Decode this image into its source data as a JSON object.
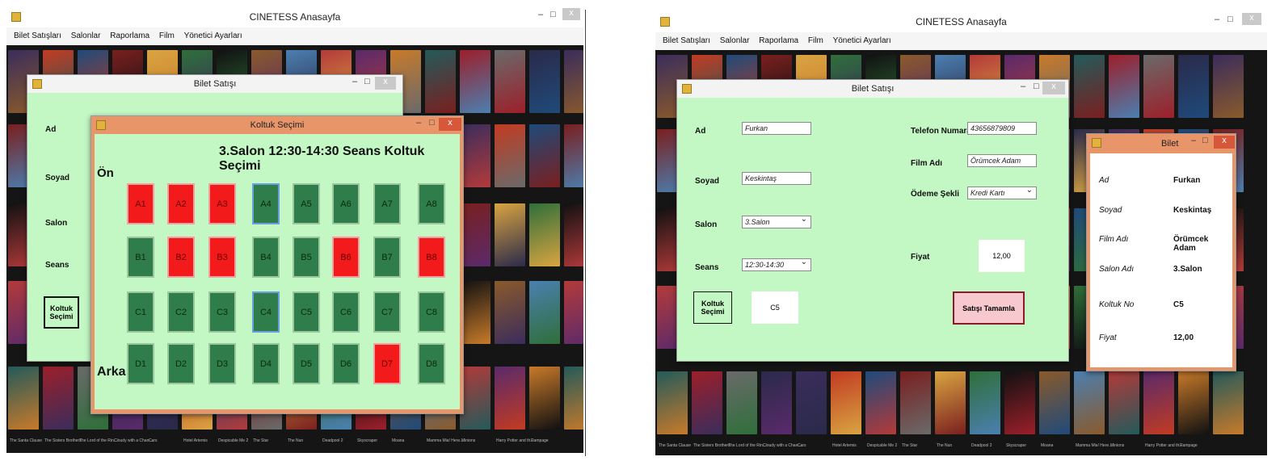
{
  "app_title": "CINETESS Anasayfa",
  "menu": [
    "Bilet Satışları",
    "Salonlar",
    "Raporlama",
    "Film",
    "Yönetici Ayarları"
  ],
  "left": {
    "bilet_window_title": "Bilet Satışı",
    "labels": {
      "ad": "Ad",
      "soyad": "Soyad",
      "salon": "Salon",
      "seans": "Seans"
    },
    "koltuk_button": "Koltuk\nSeçimi",
    "seat_window": {
      "title": "Koltuk Seçimi",
      "heading": "3.Salon 12:30-14:30 Seans Koltuk Seçimi",
      "front_label": "Ön",
      "back_label": "Arka",
      "rows": [
        {
          "row": "A",
          "seats": [
            {
              "id": "A1",
              "status": "taken"
            },
            {
              "id": "A2",
              "status": "taken"
            },
            {
              "id": "A3",
              "status": "taken"
            },
            {
              "id": "A4",
              "status": "free"
            },
            {
              "id": "A5",
              "status": "free"
            },
            {
              "id": "A6",
              "status": "free"
            },
            {
              "id": "A7",
              "status": "free"
            },
            {
              "id": "A8",
              "status": "free"
            }
          ]
        },
        {
          "row": "B",
          "seats": [
            {
              "id": "B1",
              "status": "free"
            },
            {
              "id": "B2",
              "status": "taken"
            },
            {
              "id": "B3",
              "status": "taken"
            },
            {
              "id": "B4",
              "status": "free"
            },
            {
              "id": "B5",
              "status": "free"
            },
            {
              "id": "B6",
              "status": "taken"
            },
            {
              "id": "B7",
              "status": "free"
            },
            {
              "id": "B8",
              "status": "taken"
            }
          ]
        },
        {
          "row": "C",
          "seats": [
            {
              "id": "C1",
              "status": "free"
            },
            {
              "id": "C2",
              "status": "free"
            },
            {
              "id": "C3",
              "status": "free"
            },
            {
              "id": "C4",
              "status": "free"
            },
            {
              "id": "C5",
              "status": "free"
            },
            {
              "id": "C6",
              "status": "free"
            },
            {
              "id": "C7",
              "status": "free"
            },
            {
              "id": "C8",
              "status": "free"
            }
          ]
        },
        {
          "row": "D",
          "seats": [
            {
              "id": "D1",
              "status": "free"
            },
            {
              "id": "D2",
              "status": "free"
            },
            {
              "id": "D3",
              "status": "free"
            },
            {
              "id": "D4",
              "status": "free"
            },
            {
              "id": "D5",
              "status": "free"
            },
            {
              "id": "D6",
              "status": "free"
            },
            {
              "id": "D7",
              "status": "taken"
            },
            {
              "id": "D8",
              "status": "free"
            }
          ]
        }
      ]
    },
    "poster_titles_bottom": [
      "The Santa Clause",
      "The Sisters Brothers",
      "The Lord of the Rin...",
      "Cloudy with a Chan...",
      "Cars",
      "Hotel Artemis",
      "Despicable Me 2",
      "The Star",
      "The Nun",
      "Deadpool 2",
      "Skyscraper",
      "Moana",
      "Mamma Mia! Here...",
      "Minions",
      "Harry Potter and th...",
      "Rampage"
    ]
  },
  "right": {
    "bilet_window_title": "Bilet Satışı",
    "labels": {
      "ad": "Ad",
      "soyad": "Soyad",
      "salon": "Salon",
      "seans": "Seans",
      "telefon": "Telefon Numarası",
      "film_adi": "Film Adı",
      "odeme": "Ödeme Şekli",
      "fiyat": "Fiyat"
    },
    "values": {
      "ad": "Furkan",
      "soyad": "Keskintaş",
      "salon": "3.Salon",
      "seans": "12:30-14:30",
      "telefon": "43656879809",
      "film_adi": "Örümcek Adam",
      "odeme": "Kredi Kartı",
      "fiyat": "12,00",
      "koltuk": "C5"
    },
    "koltuk_button": "Koltuk\nSeçimi",
    "complete_button": "Satışı Tamamla",
    "ticket": {
      "title": "Bilet",
      "rows": [
        {
          "label": "Ad",
          "value": "Furkan"
        },
        {
          "label": "Soyad",
          "value": "Keskintaş"
        },
        {
          "label": "Film Adı",
          "value": "Örümcek Adam"
        },
        {
          "label": "Salon Adı",
          "value": "3.Salon"
        },
        {
          "label": "Koltuk No",
          "value": "C5"
        },
        {
          "label": "Fiyat",
          "value": "12,00"
        }
      ]
    }
  },
  "window_controls": {
    "minimize": "–",
    "maximize": "□",
    "close": "x"
  },
  "colors": {
    "form_bg": "#c3f7c3",
    "seat_free": "#2e7d4a",
    "seat_taken": "#f21a1a",
    "titlebar_orange": "#e8956a"
  }
}
